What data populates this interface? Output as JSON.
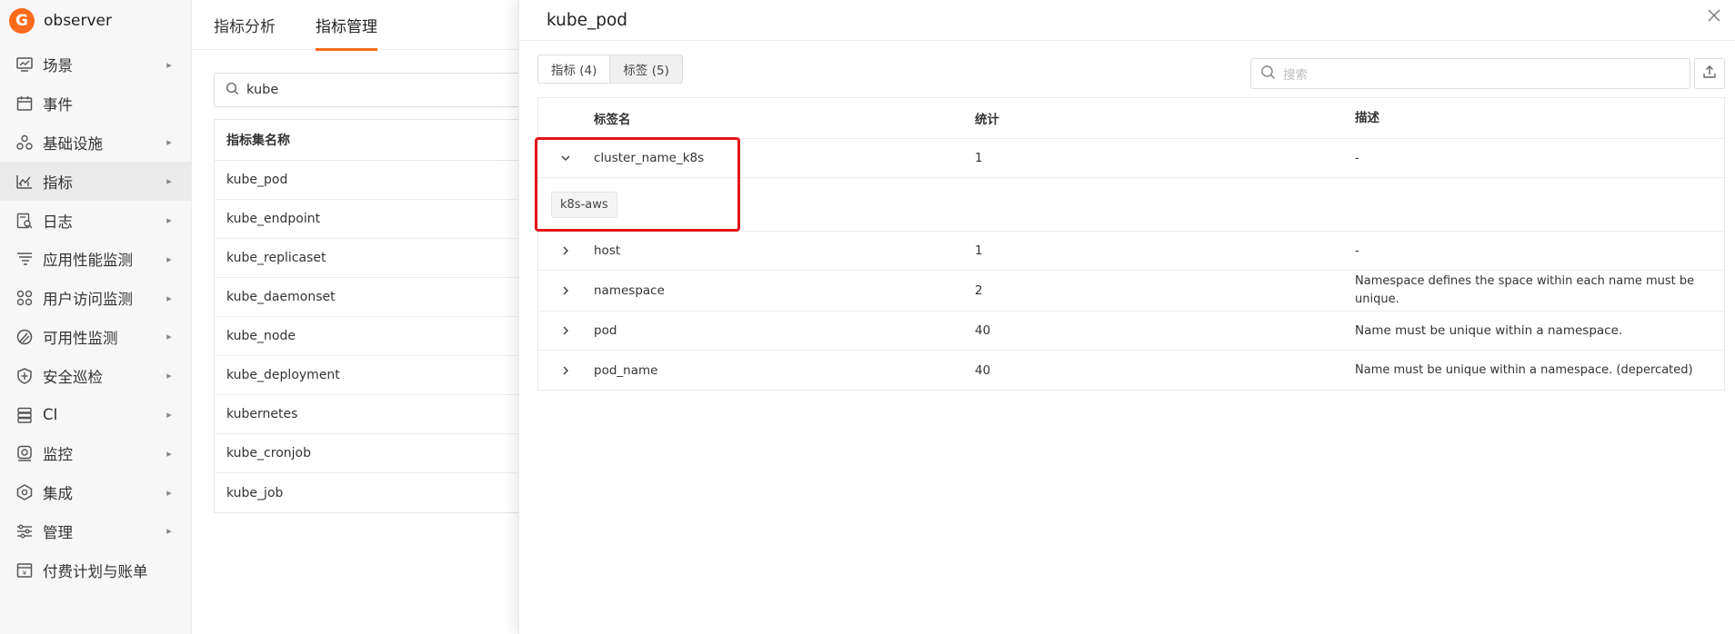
{
  "app": {
    "name": "observer",
    "logo_letter": "G",
    "accent": "#ff6b1a"
  },
  "sidebar": {
    "items": [
      {
        "label": "场景",
        "icon": "dashboard-icon",
        "has_children": true,
        "active": false
      },
      {
        "label": "事件",
        "icon": "calendar-icon",
        "has_children": false,
        "active": false
      },
      {
        "label": "基础设施",
        "icon": "hosts-icon",
        "has_children": true,
        "active": false
      },
      {
        "label": "指标",
        "icon": "metrics-chart-icon",
        "has_children": true,
        "active": true
      },
      {
        "label": "日志",
        "icon": "log-search-icon",
        "has_children": true,
        "active": false
      },
      {
        "label": "应用性能监测",
        "icon": "apm-icon",
        "has_children": true,
        "active": false
      },
      {
        "label": "用户访问监测",
        "icon": "rum-icon",
        "has_children": true,
        "active": false
      },
      {
        "label": "可用性监测",
        "icon": "dial-icon",
        "has_children": true,
        "active": false
      },
      {
        "label": "安全巡检",
        "icon": "shield-icon",
        "has_children": true,
        "active": false
      },
      {
        "label": "CI",
        "icon": "ci-icon",
        "has_children": true,
        "active": false
      },
      {
        "label": "监控",
        "icon": "monitor-icon",
        "has_children": true,
        "active": false
      },
      {
        "label": "集成",
        "icon": "integration-icon",
        "has_children": true,
        "active": false
      },
      {
        "label": "管理",
        "icon": "sliders-icon",
        "has_children": true,
        "active": false
      },
      {
        "label": "付费计划与账单",
        "icon": "billing-icon",
        "has_children": false,
        "active": false
      }
    ]
  },
  "main": {
    "tabs": [
      {
        "label": "指标分析",
        "active": false
      },
      {
        "label": "指标管理",
        "active": true
      }
    ],
    "search": {
      "value": "kube"
    },
    "metric_sets": {
      "header": "指标集名称",
      "rows": [
        "kube_pod",
        "kube_endpoint",
        "kube_replicaset",
        "kube_daemonset",
        "kube_node",
        "kube_deployment",
        "kubernetes",
        "kube_cronjob",
        "kube_job"
      ]
    }
  },
  "drawer": {
    "title": "kube_pod",
    "segments": [
      {
        "label": "指标 (4)",
        "active": false
      },
      {
        "label": "标签 (5)",
        "active": true
      }
    ],
    "search": {
      "placeholder": "搜索"
    },
    "table": {
      "headers": {
        "name": "标签名",
        "count": "统计",
        "desc": "描述"
      },
      "rows": [
        {
          "name": "cluster_name_k8s",
          "count": "1",
          "desc": "-",
          "expanded": true,
          "values": [
            "k8s-aws"
          ]
        },
        {
          "name": "host",
          "count": "1",
          "desc": "-",
          "expanded": false
        },
        {
          "name": "namespace",
          "count": "2",
          "desc": "Namespace defines the space within each name must be unique.",
          "expanded": false
        },
        {
          "name": "pod",
          "count": "40",
          "desc": "Name must be unique within a namespace.",
          "expanded": false
        },
        {
          "name": "pod_name",
          "count": "40",
          "desc": "Name must be unique within a namespace. (depercated)",
          "expanded": false
        }
      ]
    },
    "highlight_color": "#e3161b"
  }
}
